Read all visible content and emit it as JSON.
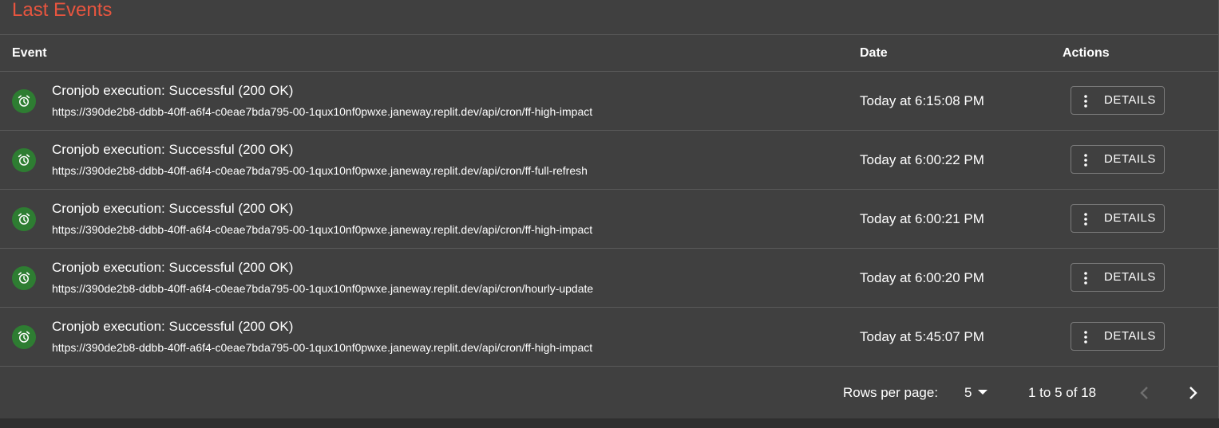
{
  "card": {
    "title": "Last Events"
  },
  "table": {
    "columns": {
      "event": "Event",
      "date": "Date",
      "actions": "Actions"
    },
    "rows": [
      {
        "title": "Cronjob execution: Successful (200 OK)",
        "url": "https://390de2b8-ddbb-40ff-a6f4-c0eae7bda795-00-1qux10nf0pwxe.janeway.replit.dev/api/cron/ff-high-impact",
        "date": "Today at 6:15:08 PM",
        "action_label": "DETAILS",
        "icon": "alarm-clock-icon"
      },
      {
        "title": "Cronjob execution: Successful (200 OK)",
        "url": "https://390de2b8-ddbb-40ff-a6f4-c0eae7bda795-00-1qux10nf0pwxe.janeway.replit.dev/api/cron/ff-full-refresh",
        "date": "Today at 6:00:22 PM",
        "action_label": "DETAILS",
        "icon": "alarm-clock-icon"
      },
      {
        "title": "Cronjob execution: Successful (200 OK)",
        "url": "https://390de2b8-ddbb-40ff-a6f4-c0eae7bda795-00-1qux10nf0pwxe.janeway.replit.dev/api/cron/ff-high-impact",
        "date": "Today at 6:00:21 PM",
        "action_label": "DETAILS",
        "icon": "alarm-clock-icon"
      },
      {
        "title": "Cronjob execution: Successful (200 OK)",
        "url": "https://390de2b8-ddbb-40ff-a6f4-c0eae7bda795-00-1qux10nf0pwxe.janeway.replit.dev/api/cron/hourly-update",
        "date": "Today at 6:00:20 PM",
        "action_label": "DETAILS",
        "icon": "alarm-clock-icon"
      },
      {
        "title": "Cronjob execution: Successful (200 OK)",
        "url": "https://390de2b8-ddbb-40ff-a6f4-c0eae7bda795-00-1qux10nf0pwxe.janeway.replit.dev/api/cron/ff-high-impact",
        "date": "Today at 5:45:07 PM",
        "action_label": "DETAILS",
        "icon": "alarm-clock-icon"
      }
    ]
  },
  "pagination": {
    "rows_per_page_label": "Rows per page:",
    "rows_per_page_value": "5",
    "range_text": "1 to 5 of 18",
    "prev_icon": "chevron-left-icon",
    "next_icon": "chevron-right-icon"
  },
  "colors": {
    "background": "#404040",
    "title_accent": "#e8553f",
    "status_success": "#2e7d32",
    "divider": "#5a5a5a"
  }
}
